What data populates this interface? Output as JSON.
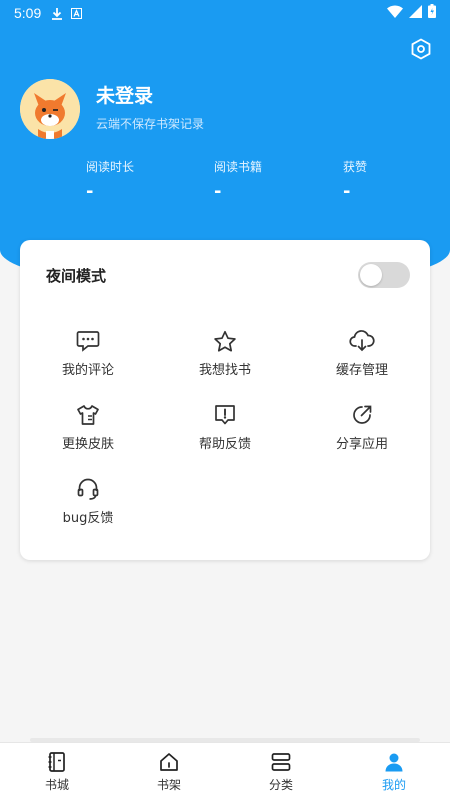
{
  "status_bar": {
    "time": "5:09"
  },
  "profile": {
    "name": "未登录",
    "subtitle": "云端不保存书架记录"
  },
  "stats": [
    {
      "label": "阅读时长",
      "value": "-"
    },
    {
      "label": "阅读书籍",
      "value": "-"
    },
    {
      "label": "获赞",
      "value": "-"
    }
  ],
  "card": {
    "night_mode_label": "夜间模式",
    "night_mode_on": false,
    "items": [
      {
        "label": "我的评论",
        "icon": "comment-icon"
      },
      {
        "label": "我想找书",
        "icon": "star-icon"
      },
      {
        "label": "缓存管理",
        "icon": "cloud-download-icon"
      },
      {
        "label": "更换皮肤",
        "icon": "shirt-icon"
      },
      {
        "label": "帮助反馈",
        "icon": "feedback-icon"
      },
      {
        "label": "分享应用",
        "icon": "share-icon"
      },
      {
        "label": "bug反馈",
        "icon": "headset-icon"
      }
    ]
  },
  "bottom_nav": {
    "items": [
      {
        "label": "书城",
        "icon": "book-icon"
      },
      {
        "label": "书架",
        "icon": "home-icon"
      },
      {
        "label": "分类",
        "icon": "category-icon"
      },
      {
        "label": "我的",
        "icon": "person-icon"
      }
    ],
    "active": "我的"
  },
  "colors": {
    "primary": "#1a9bf2",
    "background": "#f5f5f5",
    "card": "#ffffff"
  }
}
